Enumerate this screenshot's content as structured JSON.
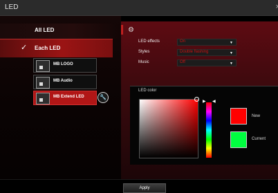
{
  "window": {
    "title": "LED",
    "close_glyph": "×"
  },
  "left": {
    "all_led": "All LED",
    "each_led": "Each LED",
    "devices": [
      {
        "name": "MB LOGO",
        "selected": false
      },
      {
        "name": "MB Audio",
        "selected": false
      },
      {
        "name": "MB Extend LED",
        "selected": true
      }
    ]
  },
  "settings": {
    "led_effects": {
      "label": "LED effects",
      "value": "On"
    },
    "styles": {
      "label": "Styles",
      "value": "Double flashing"
    },
    "music": {
      "label": "Music",
      "value": "Off"
    }
  },
  "led_color": {
    "header": "LED color",
    "new_label": "New",
    "current_label": "Current",
    "new_color": "#ff0000",
    "current_color": "#00ff40"
  },
  "footer": {
    "apply_label": "Apply"
  },
  "colors": {
    "accent": "#b11616",
    "select_value": "#cc1111"
  }
}
